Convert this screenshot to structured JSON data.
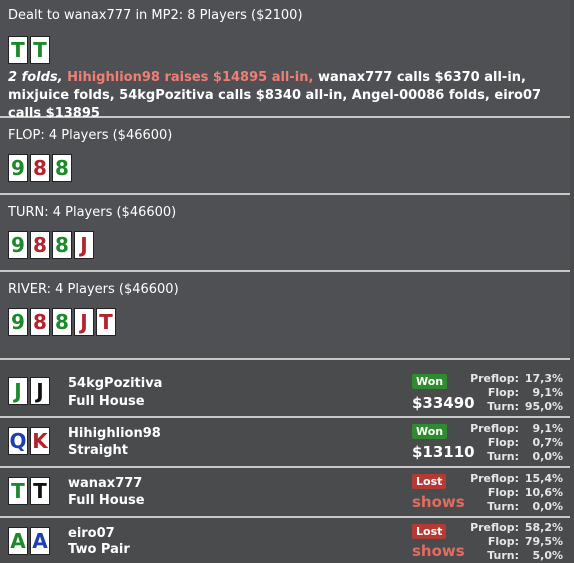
{
  "header": {
    "dealt_text": "Dealt to wanax777 in MP2: 8 Players ($2100)",
    "hole_cards": [
      {
        "rank": "T",
        "suit_color": "green"
      },
      {
        "rank": "T",
        "suit_color": "green"
      }
    ],
    "action_line": {
      "part1": "2 folds, ",
      "part2": "Hihighlion98 raises $14895 all-in, ",
      "part3": "wanax777 calls $6370 all-in, mixjuice folds, 54kgPozitiva calls $8340 all-in, Angel-00086 folds, eiro07 calls $13895"
    }
  },
  "streets": {
    "flop": {
      "title": "FLOP: 4 Players ($46600)",
      "cards": [
        {
          "rank": "9",
          "suit_color": "green"
        },
        {
          "rank": "8",
          "suit_color": "red"
        },
        {
          "rank": "8",
          "suit_color": "green"
        }
      ]
    },
    "turn": {
      "title": "TURN: 4 Players ($46600)",
      "cards": [
        {
          "rank": "9",
          "suit_color": "green"
        },
        {
          "rank": "8",
          "suit_color": "red"
        },
        {
          "rank": "8",
          "suit_color": "green"
        },
        {
          "rank": "J",
          "suit_color": "red"
        }
      ]
    },
    "river": {
      "title": "RIVER: 4 Players ($46600)",
      "cards": [
        {
          "rank": "9",
          "suit_color": "green"
        },
        {
          "rank": "8",
          "suit_color": "red"
        },
        {
          "rank": "8",
          "suit_color": "green"
        },
        {
          "rank": "J",
          "suit_color": "red"
        },
        {
          "rank": "T",
          "suit_color": "red"
        }
      ]
    }
  },
  "equity_labels": {
    "preflop": "Preflop:",
    "flop": "Flop:",
    "turn": "Turn:"
  },
  "players": [
    {
      "name": "54kgPozitiva",
      "hand": "Full House",
      "cards": [
        {
          "rank": "J",
          "suit_color": "green"
        },
        {
          "rank": "J",
          "suit_color": "black"
        }
      ],
      "result": "Won",
      "amount": "$33490",
      "preflop": "17,3%",
      "flop": "9,1%",
      "turn": "95,0%"
    },
    {
      "name": "Hihighlion98",
      "hand": "Straight",
      "cards": [
        {
          "rank": "Q",
          "suit_color": "blue"
        },
        {
          "rank": "K",
          "suit_color": "red"
        }
      ],
      "result": "Won",
      "amount": "$13110",
      "preflop": "9,1%",
      "flop": "0,7%",
      "turn": "0,0%"
    },
    {
      "name": "wanax777",
      "hand": "Full House",
      "cards": [
        {
          "rank": "T",
          "suit_color": "green"
        },
        {
          "rank": "T",
          "suit_color": "black"
        }
      ],
      "result": "Lost",
      "amount": "shows",
      "preflop": "15,4%",
      "flop": "10,6%",
      "turn": "0,0%"
    },
    {
      "name": "eiro07",
      "hand": "Two Pair",
      "cards": [
        {
          "rank": "A",
          "suit_color": "green"
        },
        {
          "rank": "A",
          "suit_color": "blue"
        }
      ],
      "result": "Lost",
      "amount": "shows",
      "preflop": "58,2%",
      "flop": "79,5%",
      "turn": "5,0%"
    }
  ]
}
